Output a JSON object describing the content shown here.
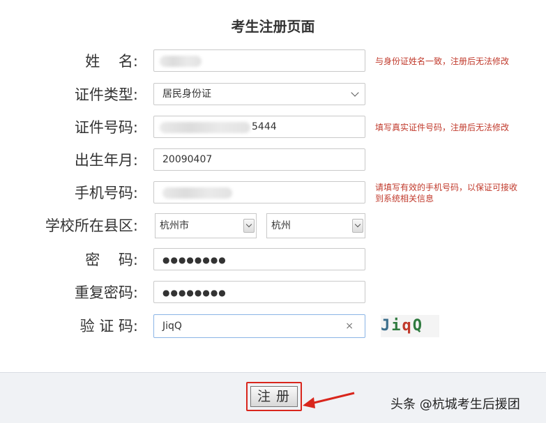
{
  "page_title": "考生注册页面",
  "labels": {
    "name": "姓    名:",
    "id_type": "证件类型:",
    "id_number": "证件号码:",
    "birth": "出生年月:",
    "phone": "手机号码:",
    "school_district": "学校所在县区:",
    "password": "密    码:",
    "confirm_password": "重复密码:",
    "captcha": "验 证 码:"
  },
  "fields": {
    "id_type_value": "居民身份证",
    "id_number_suffix": "5444",
    "birth_value": "20090407",
    "city_value": "杭州市",
    "district_value": "杭州",
    "password_mask": "●●●●●●●●",
    "confirm_password_mask": "●●●●●●●●",
    "captcha_value": "JiqQ",
    "clear_symbol": "×"
  },
  "hints": {
    "name": "与身份证姓名一致，注册后无法修改",
    "id_number": "填写真实证件号码，注册后无法修改",
    "phone_line1": "请填写有效的手机号码，以保证可接收",
    "phone_line2": "到系统相关信息"
  },
  "captcha_image_text": [
    "J",
    "i",
    "q",
    "Q"
  ],
  "register_button": "注册",
  "watermark": "头条 @杭城考生后援团",
  "colors": {
    "hint_red": "#c0392b",
    "highlight_red": "#d9261c",
    "footer_bg": "#f0f2f5"
  }
}
